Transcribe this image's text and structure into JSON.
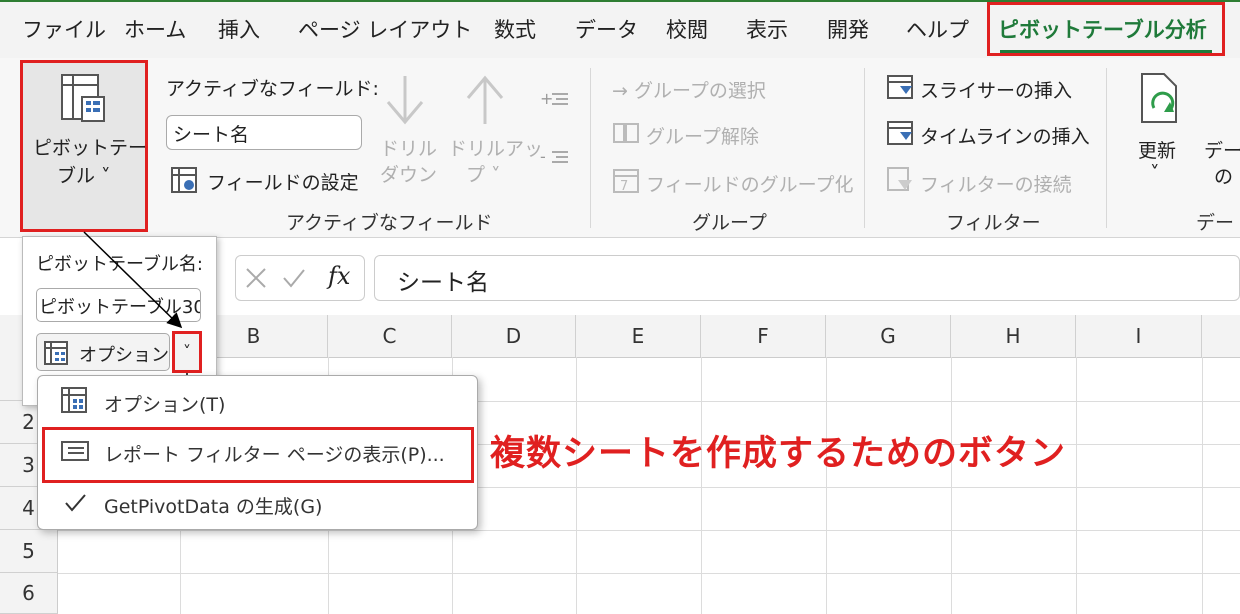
{
  "menu": {
    "tabs": [
      "ファイル",
      "ホーム",
      "挿入",
      "ページ レイアウト",
      "数式",
      "データ",
      "校閲",
      "表示",
      "開発",
      "ヘルプ",
      "ピボットテーブル分析"
    ]
  },
  "ribbon": {
    "pivottable_line1": "ピボットテー",
    "pivottable_line2": "ブル ˅",
    "active_field_label": "アクティブなフィールド:",
    "active_field_value": "シート名",
    "field_settings": "フィールドの設定",
    "drill_down_1": "ドリル",
    "drill_down_2": "ダウン",
    "drill_up_1": "ドリルアッ",
    "drill_up_2": "プ ˅",
    "group_active_field": "アクティブなフィールド",
    "group_selection": "→ グループの選択",
    "ungroup": "グループ解除",
    "field_grouping": "フィールドのグループ化",
    "group_group": "グループ",
    "insert_slicer": "スライサーの挿入",
    "insert_timeline": "タイムラインの挿入",
    "filter_connections": "フィルターの接続",
    "group_filter": "フィルター",
    "refresh": "更新",
    "refresh_chev": "˅",
    "data_partial": "デー",
    "data_partial2": "の",
    "group_data_partial": "デー"
  },
  "formula_bar": {
    "fx": "fx",
    "value": "シート名"
  },
  "grid": {
    "columns": [
      "B",
      "C",
      "D",
      "E",
      "F",
      "G",
      "H",
      "I"
    ],
    "rows": [
      "2",
      "3",
      "4",
      "5",
      "6"
    ]
  },
  "popup": {
    "name_label": "ピボットテーブル名:",
    "name_value": "ピボットテーブル30",
    "options_label": "オプション",
    "dropdown_chev": "˅"
  },
  "dropdown_menu": {
    "items": [
      {
        "label": "オプション(T)"
      },
      {
        "label": "レポート フィルター ページの表示(P)..."
      },
      {
        "label": "GetPivotData の生成(G)"
      }
    ]
  },
  "annotation": {
    "callout": "複数シートを作成するためのボタン"
  },
  "colors": {
    "accent_green": "#1f7a3a",
    "highlight_red": "#e02020"
  }
}
